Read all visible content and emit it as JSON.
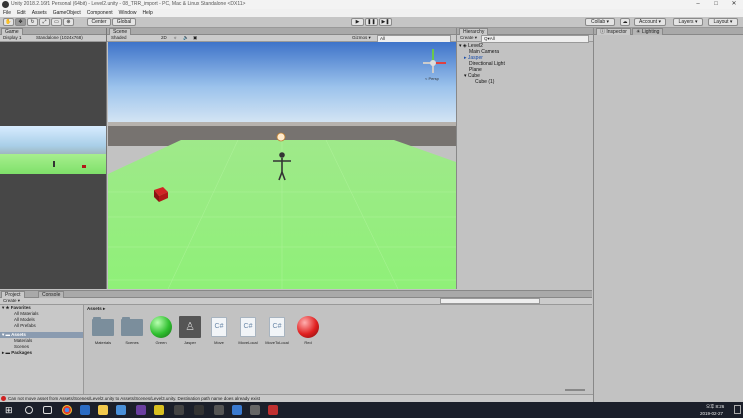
{
  "window": {
    "title": "Unity 2018.2.16f1 Personal (64bit) - Level2.unity - 08_TRR_import - PC, Mac & Linux Standalone <DX11>",
    "controls": [
      "–",
      "□",
      "✕"
    ]
  },
  "menu": [
    "File",
    "Edit",
    "Assets",
    "GameObject",
    "Component",
    "Window",
    "Help"
  ],
  "toolbar": {
    "pivot": "Center",
    "space": "Global",
    "collab": "Collab ▾",
    "account": "Account ▾",
    "layers": "Layers ▾",
    "layout": "Layout ▾"
  },
  "game": {
    "tab": "Game",
    "display": "Display 1",
    "resolution": "Standalone (1024x768)"
  },
  "scene": {
    "tab": "Scene",
    "shading": "Shaded",
    "mode2d": "2D",
    "gizmos": "Gizmos ▾",
    "search": "All",
    "persp": "< Persp"
  },
  "hierarchy": {
    "tab": "Hierarchy",
    "create": "Create ▾",
    "search": "Q▾All",
    "root": "Level2",
    "items": [
      "Main Camera",
      "Jasper",
      "Directional Light",
      "Plane",
      "Cube",
      "Cube (1)"
    ]
  },
  "inspector": {
    "tab": "Inspector",
    "tab2": "Lighting"
  },
  "project": {
    "tab": "Project",
    "tab2": "Console",
    "create": "Create ▾",
    "favorites": "Favorites",
    "fav_items": [
      "All Materials",
      "All Models",
      "All Prefabs"
    ],
    "assets": "Assets",
    "asset_children": [
      "Materials",
      "Scenes"
    ],
    "packages": "Packages",
    "breadcrumb": "Assets ▸"
  },
  "assets": [
    {
      "name": "Materials",
      "kind": "folder"
    },
    {
      "name": "Scenes",
      "kind": "folder"
    },
    {
      "name": "Green",
      "kind": "ball",
      "color": "#2fbf2f"
    },
    {
      "name": "Jasper",
      "kind": "model"
    },
    {
      "name": "Move",
      "kind": "script"
    },
    {
      "name": "MoveLocal",
      "kind": "script"
    },
    {
      "name": "MoveToLocal",
      "kind": "script"
    },
    {
      "name": "Red",
      "kind": "ball",
      "color": "#e02020"
    }
  ],
  "status": "Can not move asset from Assets/Scenes/Level2.unity to Assets/Scenes/Level3.unity. Destination path name does already exist",
  "taskbar": {
    "time": "오후 8:26",
    "date": "2019-02-27"
  }
}
